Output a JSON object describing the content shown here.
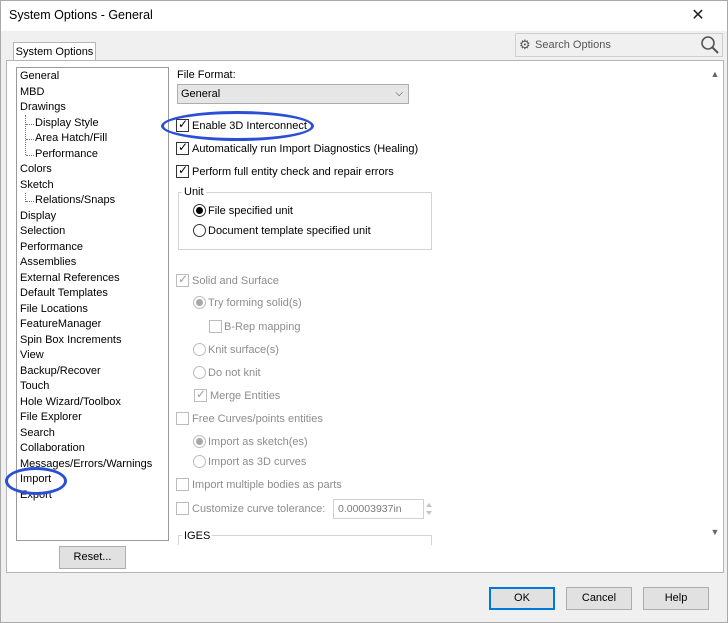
{
  "window": {
    "title": "System Options - General",
    "close_glyph": "✕"
  },
  "tabs": [
    {
      "label": "System Options"
    }
  ],
  "search": {
    "placeholder": "Search Options"
  },
  "tree": [
    {
      "label": "General",
      "indent": 0
    },
    {
      "label": "MBD",
      "indent": 0
    },
    {
      "label": "Drawings",
      "indent": 0
    },
    {
      "label": "Display Style",
      "indent": 1
    },
    {
      "label": "Area Hatch/Fill",
      "indent": 1
    },
    {
      "label": "Performance",
      "indent": 1
    },
    {
      "label": "Colors",
      "indent": 0
    },
    {
      "label": "Sketch",
      "indent": 0
    },
    {
      "label": "Relations/Snaps",
      "indent": 1
    },
    {
      "label": "Display",
      "indent": 0
    },
    {
      "label": "Selection",
      "indent": 0
    },
    {
      "label": "Performance",
      "indent": 0
    },
    {
      "label": "Assemblies",
      "indent": 0
    },
    {
      "label": "External References",
      "indent": 0
    },
    {
      "label": "Default Templates",
      "indent": 0
    },
    {
      "label": "File Locations",
      "indent": 0
    },
    {
      "label": "FeatureManager",
      "indent": 0
    },
    {
      "label": "Spin Box Increments",
      "indent": 0
    },
    {
      "label": "View",
      "indent": 0
    },
    {
      "label": "Backup/Recover",
      "indent": 0
    },
    {
      "label": "Touch",
      "indent": 0
    },
    {
      "label": "Hole Wizard/Toolbox",
      "indent": 0
    },
    {
      "label": "File Explorer",
      "indent": 0
    },
    {
      "label": "Search",
      "indent": 0
    },
    {
      "label": "Collaboration",
      "indent": 0
    },
    {
      "label": "Messages/Errors/Warnings",
      "indent": 0
    },
    {
      "label": "Import",
      "indent": 0,
      "selected": true
    },
    {
      "label": "Export",
      "indent": 0
    }
  ],
  "reset_label": "Reset...",
  "file_format": {
    "label": "File Format:",
    "value": "General"
  },
  "options": {
    "enable_3d_interconnect": {
      "label": "Enable 3D Interconnect",
      "checked": true
    },
    "auto_import_diagnostics": {
      "label": "Automatically run Import Diagnostics (Healing)",
      "checked": true
    },
    "full_entity_check": {
      "label": "Perform full entity check and repair errors",
      "checked": true
    }
  },
  "unit": {
    "group_label": "Unit",
    "file_specified": "File specified unit",
    "document_template": "Document template specified unit",
    "selected": "file_specified"
  },
  "solid_surface": {
    "label": "Solid and Surface",
    "try_forming_solids": "Try forming solid(s)",
    "brep_mapping": "B-Rep mapping",
    "knit_surfaces": "Knit surface(s)",
    "do_not_knit": "Do not knit",
    "merge_entities": "Merge Entities"
  },
  "free_curves": {
    "label": "Free Curves/points entities",
    "import_as_sketches": "Import as sketch(es)",
    "import_as_3d_curves": "Import as 3D curves"
  },
  "import_multiple_bodies": {
    "label": "Import multiple bodies as parts"
  },
  "curve_tolerance": {
    "label": "Customize curve tolerance:",
    "value": "0.00003937in"
  },
  "iges_label": "IGES",
  "buttons": {
    "ok": "OK",
    "cancel": "Cancel",
    "help": "Help"
  },
  "colors": {
    "highlight": "#2a4fd6",
    "default_button_border": "#0078d7"
  }
}
